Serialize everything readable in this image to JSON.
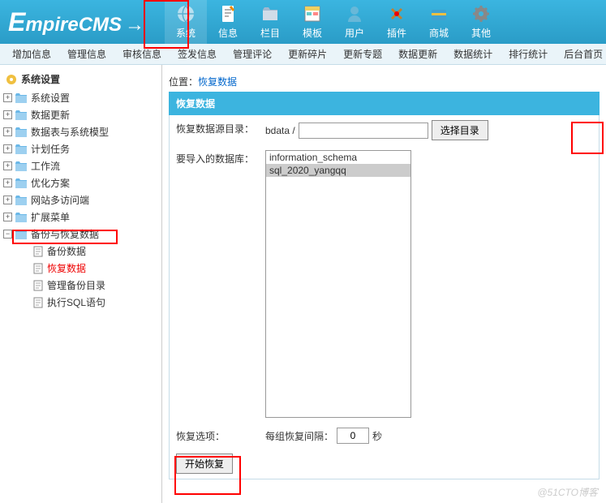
{
  "logo": "EmpireCMS",
  "topNav": [
    {
      "label": "系统"
    },
    {
      "label": "信息"
    },
    {
      "label": "栏目"
    },
    {
      "label": "模板"
    },
    {
      "label": "用户"
    },
    {
      "label": "插件"
    },
    {
      "label": "商城"
    },
    {
      "label": "其他"
    }
  ],
  "subNav": [
    "增加信息",
    "管理信息",
    "审核信息",
    "签发信息",
    "管理评论",
    "更新碎片",
    "更新专题",
    "数据更新",
    "数据统计",
    "排行统计",
    "后台首页"
  ],
  "sidebarTitle": "系统设置",
  "tree": [
    {
      "label": "系统设置"
    },
    {
      "label": "数据更新"
    },
    {
      "label": "数据表与系统模型"
    },
    {
      "label": "计划任务"
    },
    {
      "label": "工作流"
    },
    {
      "label": "优化方案"
    },
    {
      "label": "网站多访问端"
    },
    {
      "label": "扩展菜单"
    },
    {
      "label": "备份与恢复数据",
      "expanded": true,
      "children": [
        {
          "label": "备份数据"
        },
        {
          "label": "恢复数据",
          "active": true
        },
        {
          "label": "管理备份目录"
        },
        {
          "label": "执行SQL语句"
        }
      ]
    }
  ],
  "breadcrumb": {
    "prefix": "位置：",
    "current": "恢复数据"
  },
  "panelTitle": "恢复数据",
  "form": {
    "sourceDirLabel": "恢复数据源目录：",
    "sourceDirPrefix": "bdata /",
    "selectDirBtn": "选择目录",
    "dbLabel": "要导入的数据库：",
    "dbOptions": [
      {
        "label": "information_schema",
        "selected": false
      },
      {
        "label": "sql_2020_yangqq",
        "selected": true
      }
    ],
    "restoreOptionsLabel": "恢复选项：",
    "intervalLabel": "每组恢复间隔：",
    "intervalValue": "0",
    "intervalUnit": "秒",
    "submitBtn": "开始恢复"
  },
  "watermark": "@51CTO博客"
}
